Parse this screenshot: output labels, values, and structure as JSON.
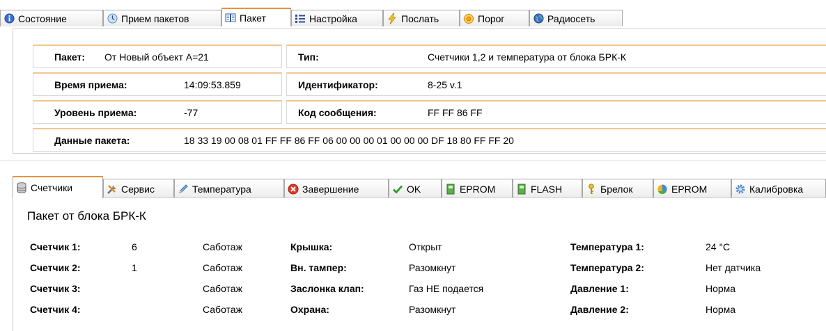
{
  "tabs": [
    {
      "label": "Состояние",
      "icon": "info-icon"
    },
    {
      "label": "Прием пакетов",
      "icon": "clock-icon"
    },
    {
      "label": "Пакет",
      "icon": "book-icon",
      "active": true
    },
    {
      "label": "Настройка",
      "icon": "list-icon"
    },
    {
      "label": "Послать",
      "icon": "lightning-icon"
    },
    {
      "label": "Порог",
      "icon": "threshold-icon"
    },
    {
      "label": "Радиосеть",
      "icon": "globe-icon"
    }
  ],
  "packet": {
    "packet_label": "Пакет:",
    "packet_value": "От Новый объект А=21",
    "type_label": "Тип:",
    "type_value": "Счетчики 1,2 и температура от блока БРК-К",
    "time_label": "Время приема:",
    "time_value": "14:09:53.859",
    "id_label": "Идентификатор:",
    "id_value": "8-25 v.1",
    "level_label": "Уровень приема:",
    "level_value": "-77",
    "code_label": "Код сообщения:",
    "code_value": "FF FF 86 FF",
    "data_label": "Данные пакета:",
    "data_value": "18 33 19 00 08 01 FF FF 86 FF 06 00 00 00 01 00 00 00 DF 18 80 FF FF 20"
  },
  "subtabs": [
    {
      "label": "Счетчики",
      "icon": "database-icon",
      "active": true
    },
    {
      "label": "Сервис",
      "icon": "tools-icon"
    },
    {
      "label": "Температура",
      "icon": "pencil-icon"
    },
    {
      "label": "Завершение",
      "icon": "stop-icon"
    },
    {
      "label": "OK",
      "icon": "checkmark-icon"
    },
    {
      "label": "EPROM",
      "icon": "chip-icon"
    },
    {
      "label": "FLASH",
      "icon": "chip-icon"
    },
    {
      "label": "Брелок",
      "icon": "key-icon"
    },
    {
      "label": "EPROM",
      "icon": "color-ball-icon"
    },
    {
      "label": "Калибровка",
      "icon": "gear-icon"
    }
  ],
  "counters": {
    "heading": "Пакет от блока БРК-К",
    "rows": [
      {
        "c_label": "Счетчик 1:",
        "c_value": "6",
        "c_state": "Саботаж",
        "m_label": "Крышка:",
        "m_value": "Открыт",
        "r_label": "Температура 1:",
        "r_value": "24 °С"
      },
      {
        "c_label": "Счетчик 2:",
        "c_value": "1",
        "c_state": "Саботаж",
        "m_label": "Вн. тампер:",
        "m_value": "Разомкнут",
        "r_label": "Температура 2:",
        "r_value": "Нет датчика"
      },
      {
        "c_label": "Счетчик 3:",
        "c_value": "",
        "c_state": "Саботаж",
        "m_label": "Заслонка клап:",
        "m_value": "Газ НЕ подается",
        "r_label": "Давление 1:",
        "r_value": "Норма"
      },
      {
        "c_label": "Счетчик 4:",
        "c_value": "",
        "c_state": "Саботаж",
        "m_label": "Охрана:",
        "m_value": "Разомкнут",
        "r_label": "Давление 2:",
        "r_value": "Норма"
      }
    ]
  },
  "colors": {
    "accent": "#e8913a",
    "box_top": "#f0c592"
  }
}
